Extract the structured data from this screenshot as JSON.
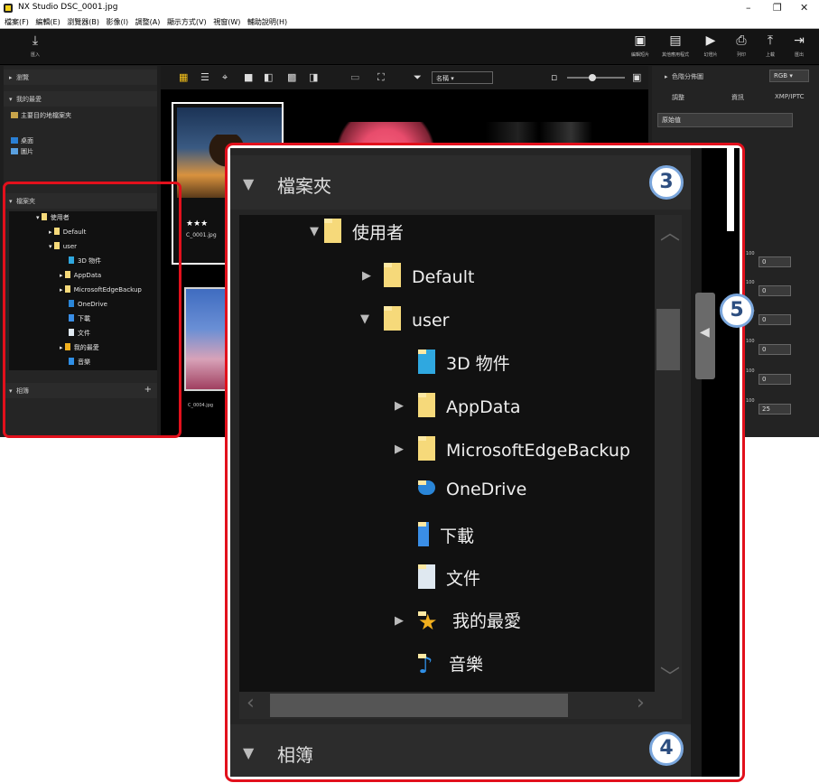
{
  "window": {
    "title": "NX Studio   DSC_0001.jpg",
    "minimize": "–",
    "maximize": "❐",
    "close": "✕"
  },
  "menu": [
    "檔案(F)",
    "編輯(E)",
    "瀏覽器(B)",
    "影像(I)",
    "調整(A)",
    "顯示方式(V)",
    "視窗(W)",
    "輔助說明(H)"
  ],
  "toolbar": {
    "import": "匯入",
    "right_buttons": [
      "編輯短片",
      "其他應用程式",
      "幻燈片",
      "列印",
      "上載",
      "匯出"
    ]
  },
  "left_panel": {
    "browse": "瀏覽",
    "favorites": "我的最愛",
    "favorites_items": [
      "主要目的地檔案夾",
      "桌面",
      "圖片"
    ],
    "folders": "檔案夾",
    "albums": "相簿",
    "album_add": "+"
  },
  "tree": {
    "root": "使用者",
    "default": "Default",
    "user": "user",
    "children": [
      "3D 物件",
      "AppData",
      "MicrosoftEdgeBackup",
      "OneDrive",
      "下載",
      "文件",
      "我的最愛",
      "音樂"
    ]
  },
  "center": {
    "sort_label": "名稱",
    "thumb_stars": "★★★",
    "thumb1_name": "C_0001.jpg",
    "thumb4_name": "C_0004.jpg"
  },
  "right_panel": {
    "histogram": "色階分佈圖",
    "rgb": "RGB",
    "tabs": [
      "調整",
      "資訊",
      "XMP/IPTC"
    ],
    "preset": "原始值",
    "values": [
      "0",
      "0",
      "0",
      "0",
      "0",
      "25"
    ],
    "ticks": [
      "100",
      "100",
      "100",
      "100",
      "100",
      "100"
    ]
  },
  "callout": {
    "badges": [
      "3",
      "4",
      "5"
    ],
    "collapse_arrow": "◀"
  },
  "colors": {
    "highlight": "#e2101c",
    "badge_border": "#7aa6dc",
    "folder": "#f6d97a"
  }
}
